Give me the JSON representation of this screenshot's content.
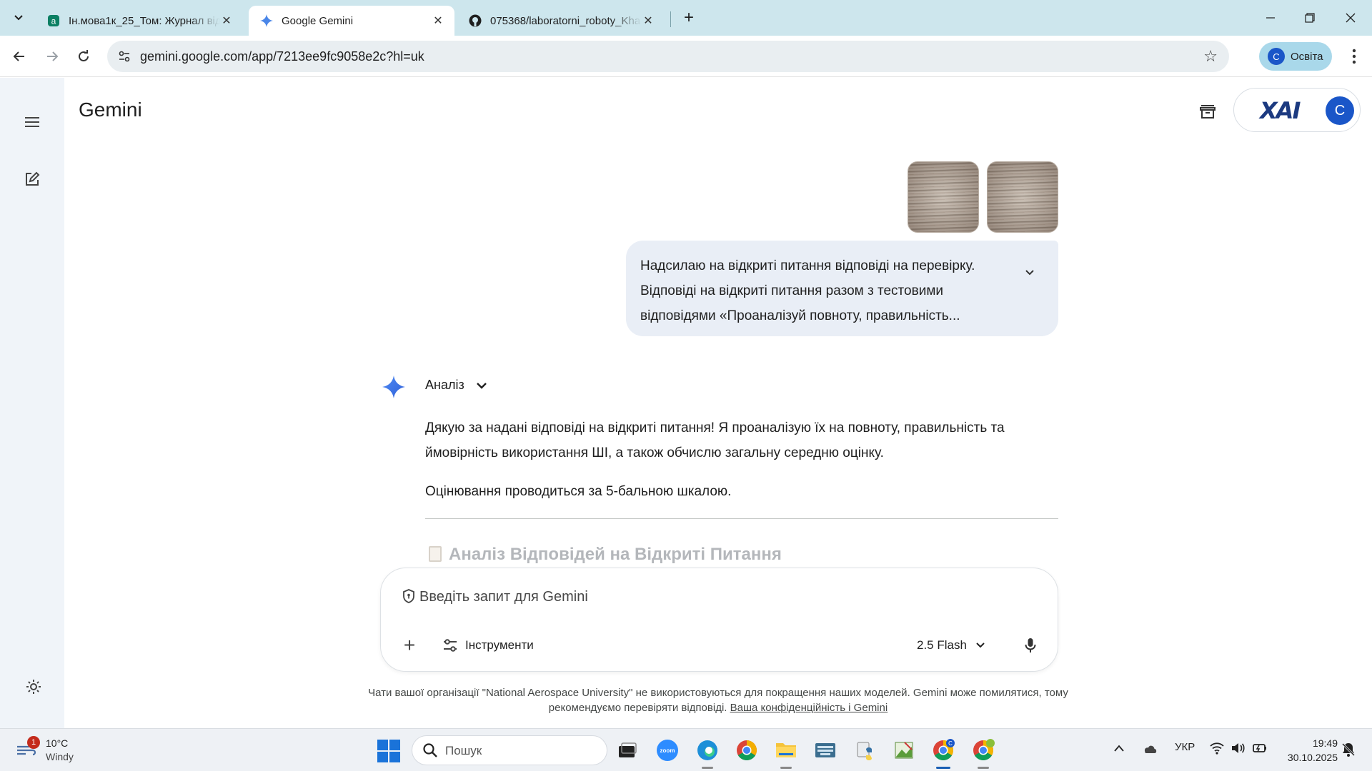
{
  "browser": {
    "tabs": [
      {
        "title": "Ін.мова1к_25_Том: Журнал від",
        "close": "✕"
      },
      {
        "title": "Google Gemini",
        "close": "✕"
      },
      {
        "title": "075368/laboratorni_roboty_Kha",
        "close": "✕"
      }
    ],
    "url": "gemini.google.com/app/7213ee9fc9058e2c?hl=uk",
    "profile_chip": {
      "initial": "C",
      "label": "Освіта"
    }
  },
  "app": {
    "title": "Gemini",
    "account_logo": "XAI",
    "account_initial": "C"
  },
  "conversation": {
    "user_message_lines": [
      "Надсилаю на відкриті питання відповіді на перевірку.",
      "Відповіді на відкриті питання разом з тестовими",
      "відповідями  «Проаналізуй повноту, правильність..."
    ],
    "response_header": "Аналіз",
    "response_paragraph1_lines": [
      "Дякую за надані відповіді на відкриті питання! Я проаналізую їх на повноту, правильність та",
      "ймовірність використання ШІ, а також обчислю загальну середню оцінку."
    ],
    "response_paragraph2": "Оцінювання проводиться за 5-бальною шкалою.",
    "faded_heading": "Аналіз Відповідей на Відкриті Питання"
  },
  "composer": {
    "placeholder": "Введіть запит для Gemini",
    "tools_label": "Інструменти",
    "model_label": "2.5 Flash"
  },
  "disclaimer": {
    "line1": "Чати вашої організації \"National Aerospace University\" не використовуються для покращення наших моделей. Gemini може помилятися, тому",
    "line2_prefix": "рекомендуємо перевіряти відповіді. ",
    "link": "Ваша конфіденційність і Gemini"
  },
  "taskbar": {
    "weather_badge": "1",
    "weather_temp": "10°C",
    "weather_desc": "Windy",
    "search_label": "Пошук",
    "zoom_label": "zoom",
    "language": "УКР",
    "time": "19:49",
    "date": "30.10.2025"
  },
  "colors": {
    "tabbar_bg": "#cde6ed",
    "accent_blue": "#1a56c8",
    "user_bubble_bg": "#e9eef6",
    "sidenav_bg": "#f0f4f9"
  }
}
